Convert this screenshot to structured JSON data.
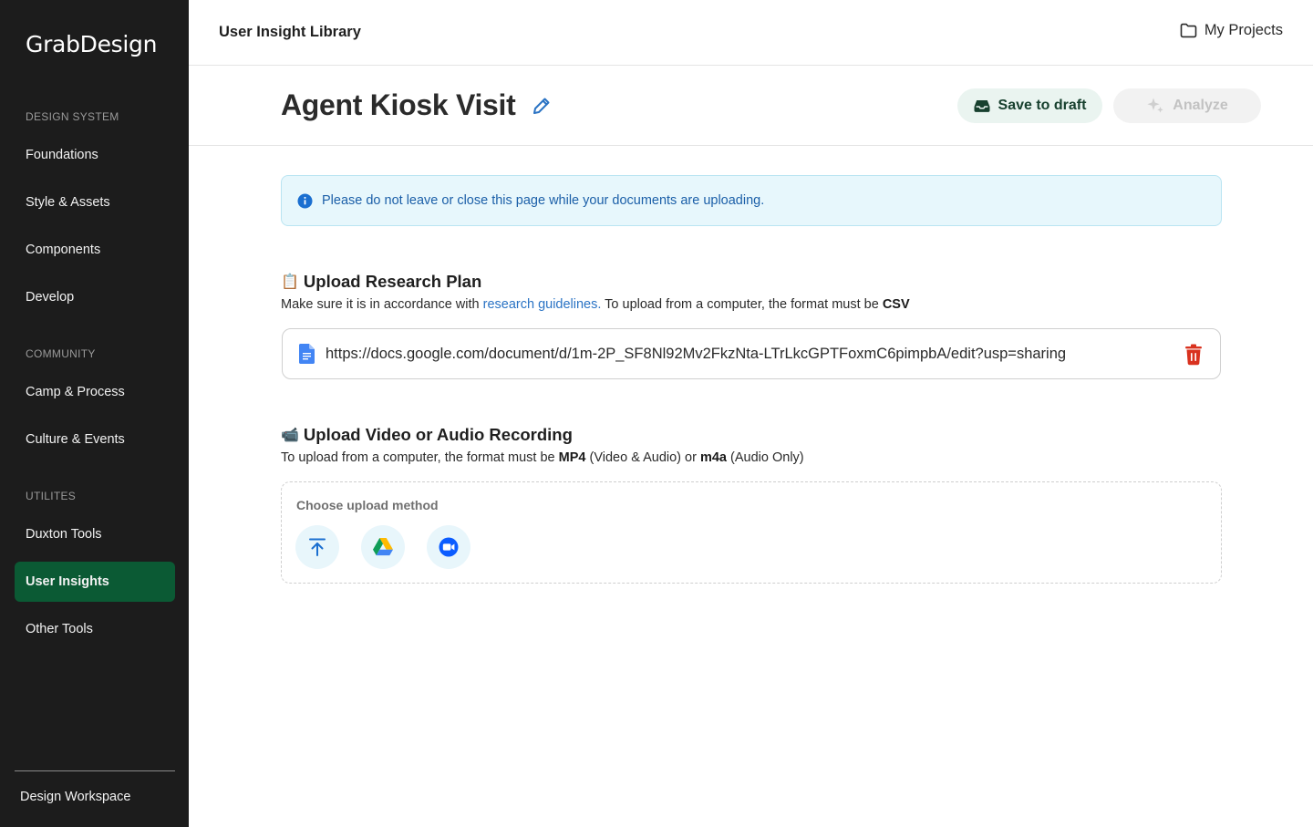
{
  "sidebar": {
    "logo": "GrabDesign",
    "sections": [
      {
        "title": "DESIGN SYSTEM",
        "items": [
          "Foundations",
          "Style & Assets",
          "Components",
          "Develop"
        ]
      },
      {
        "title": "COMMUNITY",
        "items": [
          "Camp & Process",
          "Culture & Events"
        ]
      },
      {
        "title": "UTILITES",
        "items": [
          "Duxton Tools",
          "User Insights",
          "Other Tools"
        ]
      }
    ],
    "active_item": "User Insights",
    "workspace": "Design Workspace"
  },
  "topbar": {
    "title": "User Insight Library",
    "my_projects": "My Projects"
  },
  "header": {
    "title": "Agent Kiosk Visit",
    "save_label": "Save to draft",
    "analyze_label": "Analyze"
  },
  "notice": {
    "text": "Please do not leave or close this page while your documents are uploading."
  },
  "research_plan": {
    "emoji": "📋",
    "title": "Upload Research Plan",
    "desc_prefix": "Make sure it is in accordance with ",
    "link": "research guidelines.",
    "desc_mid": " To upload from a computer, the format must be ",
    "format": "CSV",
    "file_url": "https://docs.google.com/document/d/1m-2P_SF8Nl92Mv2FkzNta-LTrLkcGPTFoxmC6pimpbA/edit?usp=sharing"
  },
  "recording": {
    "emoji": "📹",
    "title": "Upload Video or Audio Recording",
    "desc_prefix": "To upload from a computer, the format must be ",
    "format1": "MP4",
    "format1_note": " (Video & Audio) or ",
    "format2": "m4a",
    "format2_note": " (Audio Only)",
    "choose_label": "Choose upload method"
  },
  "colors": {
    "sidebar_bg": "#1c1c1c",
    "active_nav": "#0b5a34",
    "notice_bg": "#e7f7fc",
    "notice_text": "#1b5fa8",
    "danger": "#d9321f"
  }
}
